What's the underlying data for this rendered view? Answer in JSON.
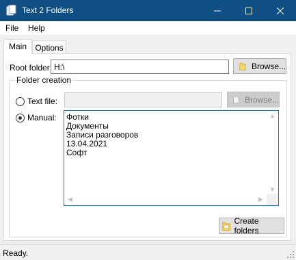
{
  "window": {
    "title": "Text 2 Folders",
    "accent": "#0f4f83",
    "icons": {
      "app": "document-stack-icon",
      "minimize": "minimize-icon",
      "maximize": "maximize-icon",
      "close": "close-icon"
    }
  },
  "menu": {
    "items": [
      "File",
      "Help"
    ]
  },
  "tabs": [
    {
      "label": "Main",
      "selected": true
    },
    {
      "label": "Options",
      "selected": false
    }
  ],
  "root": {
    "label": "Root folder:",
    "value": "H:\\",
    "browse_label": "Browse..."
  },
  "folder_creation": {
    "legend": "Folder creation",
    "text_file": {
      "label": "Text file:",
      "value": "",
      "browse_label": "Browse...",
      "selected": false,
      "enabled": false
    },
    "manual": {
      "label": "Manual:",
      "selected": true,
      "lines": [
        "Фотки",
        "Документы",
        "Записи разговоров",
        "13.04.2021",
        "Софт"
      ]
    }
  },
  "create_button": {
    "label": "Create folders",
    "icon": "folder-create-icon"
  },
  "status": {
    "text": "Ready."
  }
}
